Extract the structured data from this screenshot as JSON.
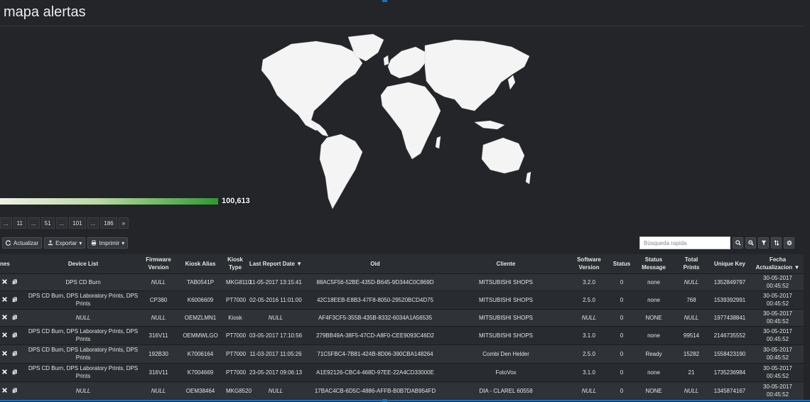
{
  "page": {
    "title": "mapa alertas"
  },
  "legend": {
    "max_value": "100,613"
  },
  "pagination": [
    "...",
    "11",
    "...",
    "51",
    "...",
    "101",
    "...",
    "186",
    "»"
  ],
  "toolbar": {
    "refresh": "Actualizar",
    "export": "Exportar",
    "print": "Imprimir"
  },
  "search": {
    "placeholder": "Búsqueda rapida"
  },
  "table": {
    "headers": [
      "nes",
      "Device List",
      "Firmware Version",
      "Kiosk Alias",
      "Kiosk Type",
      "Last Report Date",
      "Oid",
      "Cliente",
      "Software Version",
      "Status",
      "Status Message",
      "Total Prints",
      "Unique Key",
      "Fecha Actualizacion"
    ],
    "rows": [
      [
        "DPS CD Burn",
        "NULL",
        "TAB0541P",
        "MKG8110",
        "11-05-2017 13:15:41",
        "88AC5F56-52BE-435D-B645-9D344C0C869D",
        "MITSUBISHI SHOPS",
        "3.2.0",
        "0",
        "none",
        "NULL",
        "1352849797",
        "30-05-2017 00:45:52"
      ],
      [
        "DPS CD Burn, DPS Laboratory Prints, DPS Prints",
        "CP380",
        "K6006609",
        "PT7000",
        "02-05-2016 11:01:00",
        "42C18EEB-E8B3-47F8-8050-29520BCD4D75",
        "MITSUBISHI SHOPS",
        "2.5.0",
        "0",
        "none",
        "768",
        "1539392991",
        "30-05-2017 00:45:52"
      ],
      [
        "NULL",
        "NULL",
        "OEMZLMN1",
        "Kiosk",
        "NULL",
        "AF4F3CF5-355B-435B-8332-6034A1A56535",
        "MITSUBISHI SHOPS",
        "NULL",
        "0",
        "NONE",
        "NULL",
        "1977438841",
        "30-05-2017 00:45:52"
      ],
      [
        "DPS CD Burn, DPS Laboratory Prints, DPS Prints",
        "316V11",
        "OEMMWLGO",
        "PT7000",
        "03-05-2017 17:10:56",
        "279BB49A-38F5-47CD-A8F0-CEE9093C46D2",
        "MITSUBISHI SHOPS",
        "3.1.0",
        "0",
        "none",
        "99514",
        "2146735552",
        "30-05-2017 00:45:52"
      ],
      [
        "DPS CD Burn, DPS Laboratory Prints, DPS Prints",
        "192B30",
        "K7006164",
        "PT7000",
        "11-03-2017 11:05:26",
        "71C5FBC4-7B81-424B-8D06-390CBA148264",
        "Combi Den Helder",
        "2.5.0",
        "0",
        "Ready",
        "15282",
        "1558423190",
        "30-05-2017 00:45:52"
      ],
      [
        "DPS CD Burn, DPS Laboratory Prints, DPS Prints",
        "316V11",
        "K7004669",
        "PT7000",
        "23-05-2017 09:06:13",
        "A1E92126-CBC4-468D-97EE-22A4CD33000E",
        "FotoVox",
        "3.1.0",
        "0",
        "none",
        "21",
        "1735236984",
        "30-05-2017 00:45:52"
      ],
      [
        "NULL",
        "NULL",
        "OEM38464",
        "MKG8520",
        "NULL",
        "17BAC4CB-6D5C-4886-AFFB-B0B7DAB954FD",
        "DIA - CLAREL 60558",
        "NULL",
        "0",
        "NONE",
        "NULL",
        "1345874167",
        "30-05-2017 00:45:52"
      ]
    ]
  },
  "colors": {
    "background": "#232529",
    "legend_high": "#2e9a2e",
    "legend_low": "#f0f0e6",
    "accent": "#1f6fb8"
  }
}
